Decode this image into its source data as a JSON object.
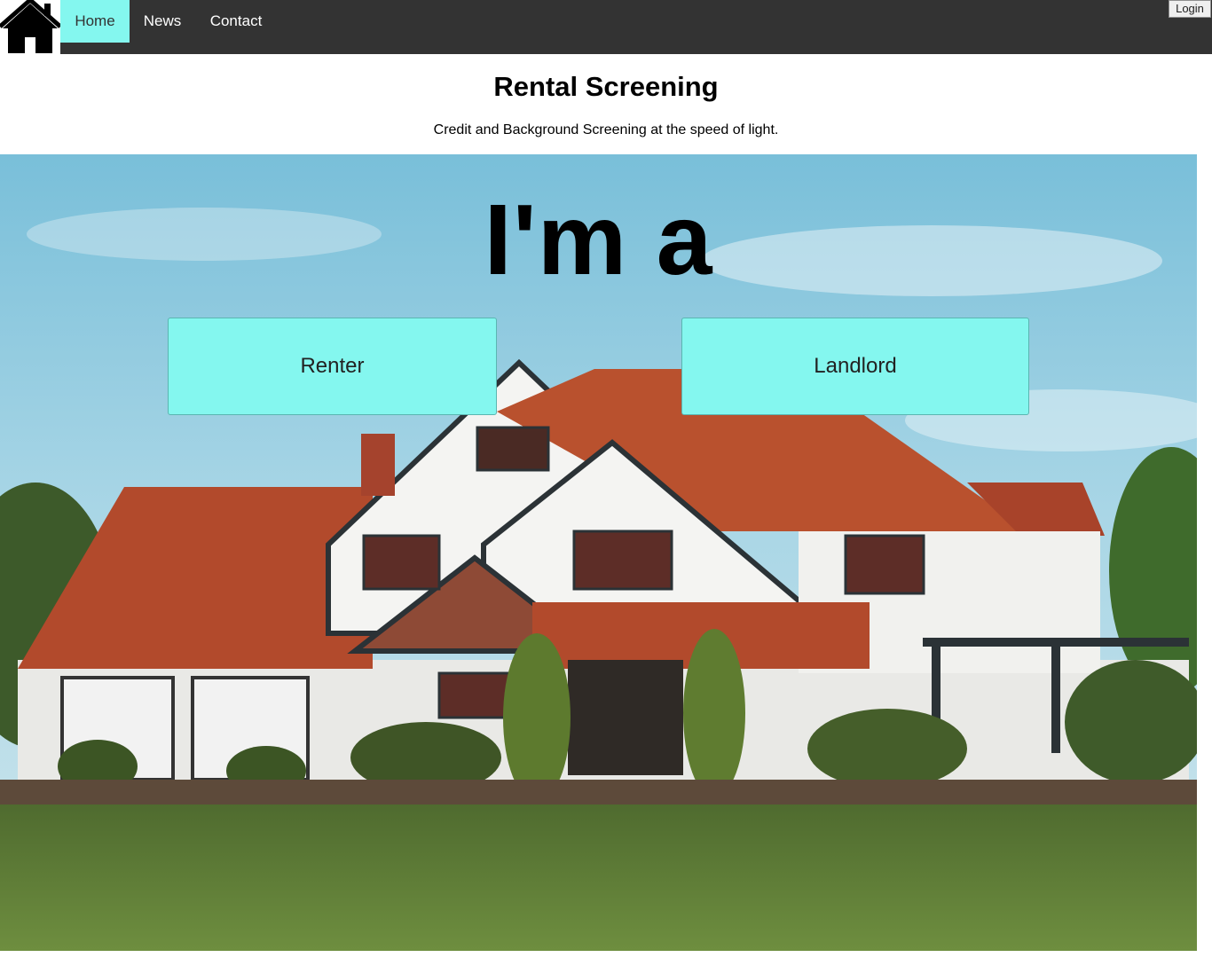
{
  "nav": {
    "logo_icon": "house-icon",
    "links": [
      {
        "label": "Home",
        "active": true
      },
      {
        "label": "News",
        "active": false
      },
      {
        "label": "Contact",
        "active": false
      }
    ],
    "login_label": "Login"
  },
  "header": {
    "title": "Rental Screening",
    "subtitle": "Credit and Background Screening at the speed of light."
  },
  "hero": {
    "heading": "I'm a",
    "background": "house-photo",
    "choices": [
      {
        "label": "Renter"
      },
      {
        "label": "Landlord"
      }
    ]
  },
  "colors": {
    "nav_bg": "#333333",
    "accent": "#84f7ef"
  }
}
